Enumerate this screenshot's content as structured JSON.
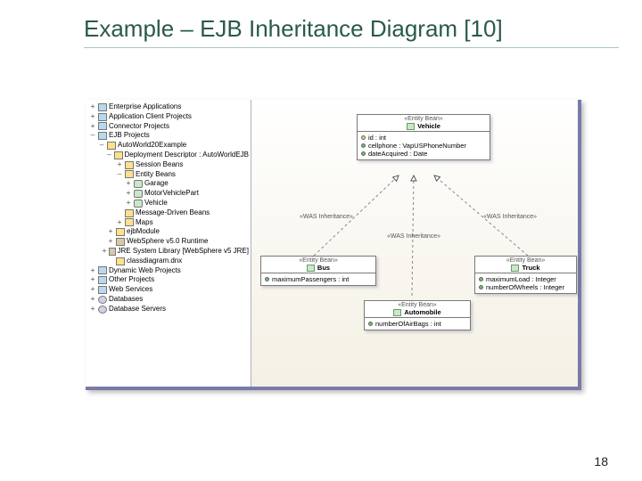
{
  "slide": {
    "title": "Example – EJB Inheritance Diagram [10]",
    "page_number": "18"
  },
  "tree": {
    "items": [
      {
        "indent": 0,
        "pm": "+",
        "icon": "proj",
        "label": "Enterprise Applications"
      },
      {
        "indent": 0,
        "pm": "+",
        "icon": "proj",
        "label": "Application Client Projects"
      },
      {
        "indent": 0,
        "pm": "+",
        "icon": "proj",
        "label": "Connector Projects"
      },
      {
        "indent": 0,
        "pm": "–",
        "icon": "proj",
        "label": "EJB Projects"
      },
      {
        "indent": 1,
        "pm": "–",
        "icon": "folder",
        "label": "AutoWorld20Example"
      },
      {
        "indent": 2,
        "pm": "–",
        "icon": "folder",
        "label": "Deployment Descriptor : AutoWorldEJB"
      },
      {
        "indent": 3,
        "pm": "+",
        "icon": "folder",
        "label": "Session Beans"
      },
      {
        "indent": 3,
        "pm": "–",
        "icon": "folder",
        "label": "Entity Beans"
      },
      {
        "indent": 4,
        "pm": "+",
        "icon": "bean",
        "label": "Garage"
      },
      {
        "indent": 4,
        "pm": "+",
        "icon": "bean",
        "label": "MotorVehiclePart"
      },
      {
        "indent": 4,
        "pm": "+",
        "icon": "bean",
        "label": "Vehicle"
      },
      {
        "indent": 3,
        "pm": " ",
        "icon": "folder",
        "label": "Message-Driven Beans"
      },
      {
        "indent": 3,
        "pm": "+",
        "icon": "folder",
        "label": "Maps"
      },
      {
        "indent": 2,
        "pm": "+",
        "icon": "folder",
        "label": "ejbModule"
      },
      {
        "indent": 2,
        "pm": "+",
        "icon": "jar",
        "label": "WebSphere v5.0 Runtime"
      },
      {
        "indent": 2,
        "pm": "+",
        "icon": "jar",
        "label": "JRE System Library [WebSphere v5 JRE]"
      },
      {
        "indent": 2,
        "pm": " ",
        "icon": "folder",
        "label": "classdiagram.dnx"
      },
      {
        "indent": 0,
        "pm": "+",
        "icon": "proj",
        "label": "Dynamic Web Projects"
      },
      {
        "indent": 0,
        "pm": "+",
        "icon": "proj",
        "label": "Other Projects"
      },
      {
        "indent": 0,
        "pm": "+",
        "icon": "proj",
        "label": "Web Services"
      },
      {
        "indent": 0,
        "pm": "+",
        "icon": "db",
        "label": "Databases"
      },
      {
        "indent": 0,
        "pm": "+",
        "icon": "db",
        "label": "Database Servers"
      }
    ]
  },
  "uml": {
    "stereotype": "«Entity Bean»",
    "inheritance_label": "«WAS Inheritance»",
    "vehicle": {
      "name": "Vehicle",
      "attrs": [
        {
          "vis": "y",
          "text": "id : int"
        },
        {
          "vis": "g",
          "text": "cellphone : VapUSPhoneNumber"
        },
        {
          "vis": "g",
          "text": "dateAcquired : Date"
        }
      ]
    },
    "bus": {
      "name": "Bus",
      "attrs": [
        {
          "vis": "g",
          "text": "maximumPassengers : int"
        }
      ]
    },
    "truck": {
      "name": "Truck",
      "attrs": [
        {
          "vis": "g",
          "text": "maximumLoad : Integer"
        },
        {
          "vis": "g",
          "text": "numberOfWheels : Integer"
        }
      ]
    },
    "automobile": {
      "name": "Automobile",
      "attrs": [
        {
          "vis": "g",
          "text": "numberOfAirBags : int"
        }
      ]
    }
  }
}
